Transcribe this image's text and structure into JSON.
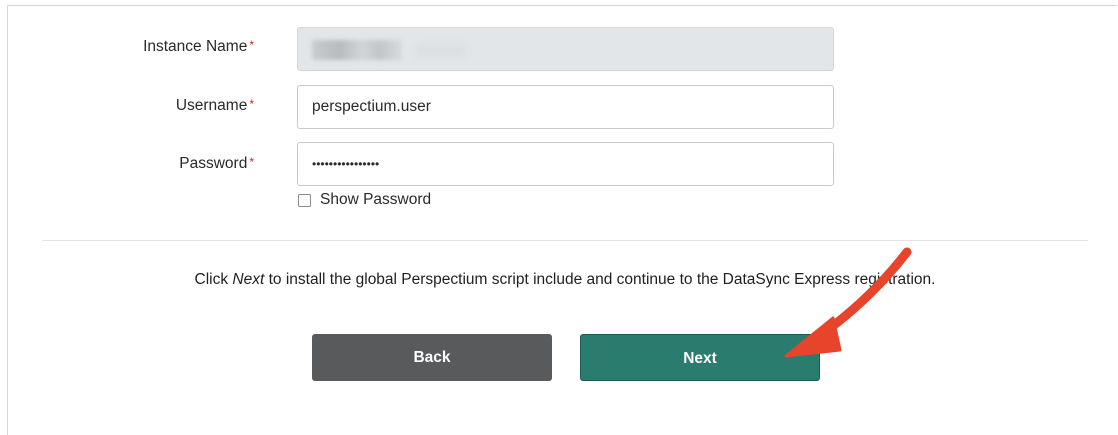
{
  "form": {
    "instance_label": "Instance Name",
    "username_label": "Username",
    "password_label": "Password",
    "required_mark": "*",
    "username_value": "perspectium.user",
    "password_value": "••••••••••••••••",
    "show_password_label": "Show Password"
  },
  "instruction": {
    "prefix": "Click ",
    "emphasis": "Next",
    "suffix": " to install the global Perspectium script include and continue to the DataSync Express registration."
  },
  "buttons": {
    "back_label": "Back",
    "next_label": "Next"
  },
  "colors": {
    "next_button": "#297c6e",
    "back_button": "#595a5c",
    "arrow": "#e8442c",
    "required": "#c62828"
  }
}
